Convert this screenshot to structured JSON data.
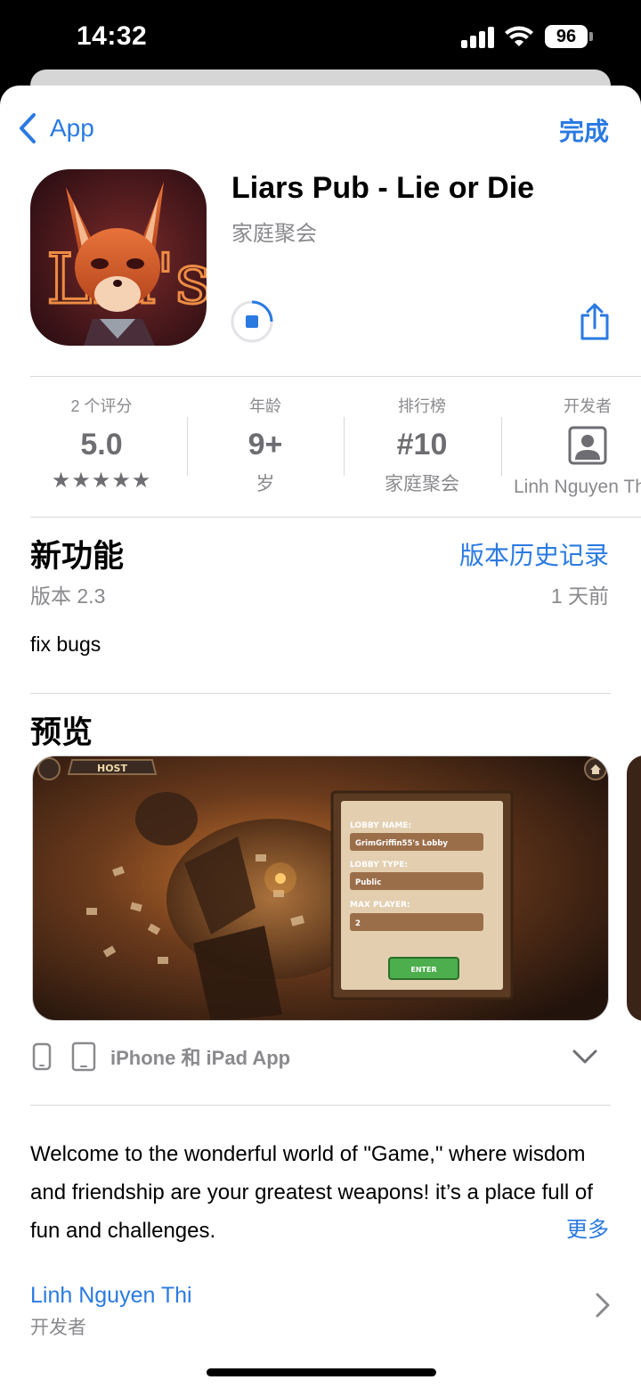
{
  "status_bar": {
    "time": "14:32",
    "battery": "96"
  },
  "nav": {
    "back_label": "App",
    "done_label": "完成"
  },
  "app": {
    "title": "Liars Pub - Lie or Die",
    "category": "家庭聚会"
  },
  "stats": [
    {
      "label": "2 个评分",
      "value": "5.0",
      "foot": "★★★★★"
    },
    {
      "label": "年龄",
      "value": "9+",
      "foot": "岁"
    },
    {
      "label": "排行榜",
      "value": "#10",
      "foot": "家庭聚会"
    },
    {
      "label": "开发者",
      "value": "",
      "foot": "Linh Nguyen Thi"
    }
  ],
  "whats_new": {
    "title": "新功能",
    "history_link": "版本历史记录",
    "version": "版本 2.3",
    "age": "1 天前",
    "notes": "fix bugs"
  },
  "preview": {
    "title": "预览",
    "screenshot": {
      "host_label": "HOST",
      "lobby_name_label": "LOBBY NAME:",
      "lobby_name_value": "GrimGriffin55's Lobby",
      "lobby_type_label": "LOBBY TYPE:",
      "lobby_type_value": "Public",
      "max_player_label": "MAX PLAYER:",
      "max_player_value": "2",
      "enter_label": "ENTER"
    },
    "devices_label": "iPhone 和 iPad App"
  },
  "description": {
    "text": "Welcome to the wonderful world of \"Game,\" where wisdom and friendship are your greatest weapons! it’s a place full of fun and challenges.",
    "more_label": "更多"
  },
  "developer": {
    "name": "Linh Nguyen Thi",
    "role": "开发者"
  },
  "colors": {
    "accent": "#2a7ae2",
    "secondary_text": "#8a8a8e"
  }
}
